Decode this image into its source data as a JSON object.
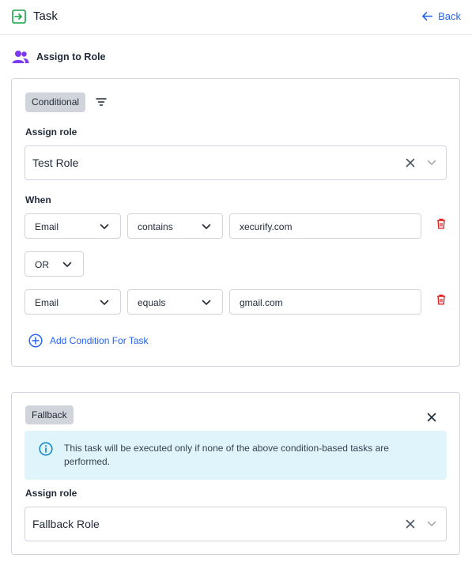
{
  "header": {
    "title": "Task",
    "back_label": "Back",
    "icons": {
      "task": "task-icon",
      "back": "arrow-left-icon"
    }
  },
  "section": {
    "title": "Assign to Role",
    "icon": "users-icon"
  },
  "conditional": {
    "badge": "Conditional",
    "assign_role_label": "Assign role",
    "assign_role_value": "Test Role",
    "when_label": "When",
    "conditions": [
      {
        "field": "Email",
        "operator": "contains",
        "value": "xecurify.com"
      },
      {
        "field": "Email",
        "operator": "equals",
        "value": "gmail.com"
      }
    ],
    "joiner": "OR",
    "add_condition_label": "Add Condition For Task"
  },
  "fallback": {
    "badge": "Fallback",
    "info_text": "This task will be executed only if none of the above condition-based tasks are performed.",
    "assign_role_label": "Assign role",
    "assign_role_value": "Fallback Role"
  },
  "colors": {
    "accent": "#2563eb",
    "danger": "#dc2626",
    "green": "#16a34a",
    "purple": "#7c3aed",
    "info_bg": "#e0f4fb"
  }
}
